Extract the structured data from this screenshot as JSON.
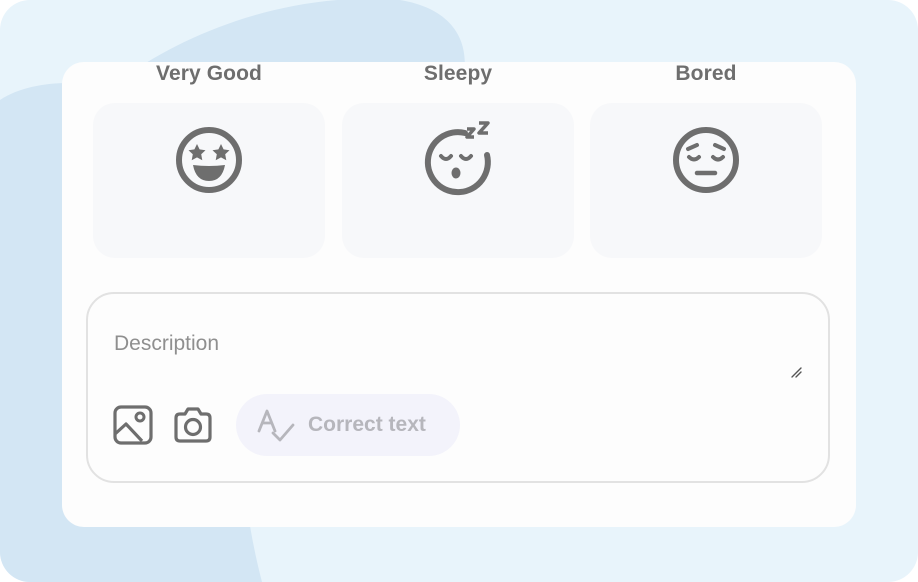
{
  "moods": [
    {
      "label": "Very Good",
      "icon": "star-struck-face-icon"
    },
    {
      "label": "Sleepy",
      "icon": "sleeping-face-icon"
    },
    {
      "label": "Bored",
      "icon": "pensive-face-icon"
    }
  ],
  "description": {
    "placeholder": "Description",
    "value": ""
  },
  "toolbar": {
    "image_icon": "image-icon",
    "camera_icon": "camera-icon",
    "correct_text_label": "Correct text",
    "correct_text_icon": "spellcheck-icon"
  },
  "colors": {
    "background": "#e8f4fb",
    "blob": "#d3e6f4",
    "card": "#fdfdfd",
    "mood_tile": "#f7f8fa",
    "icon_gray": "#6e6e6e",
    "correct_button": "#f3f3fb",
    "correct_text": "#b6b6bc"
  }
}
